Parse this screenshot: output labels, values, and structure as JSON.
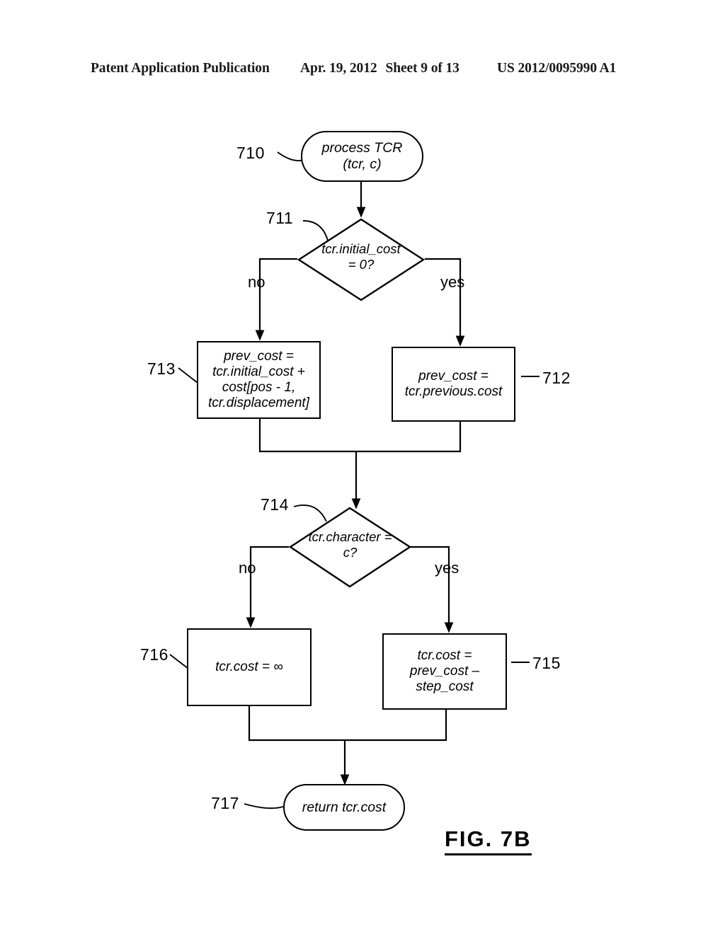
{
  "header": {
    "publication": "Patent Application Publication",
    "date": "Apr. 19, 2012",
    "sheet": "Sheet 9 of 13",
    "document_number": "US 2012/0095990 A1"
  },
  "figure": {
    "caption": "FIG. 7B"
  },
  "flowchart": {
    "nodes": [
      {
        "id": "710",
        "ref": "710",
        "type": "terminal",
        "text": "process TCR\n(tcr, c)"
      },
      {
        "id": "711",
        "ref": "711",
        "type": "decision",
        "text": "tcr.initial_cost\n= 0?"
      },
      {
        "id": "712",
        "ref": "712",
        "type": "process",
        "text": "prev_cost =\ntcr.previous.cost"
      },
      {
        "id": "713",
        "ref": "713",
        "type": "process",
        "text": "prev_cost =\ntcr.initial_cost +\ncost[pos - 1,\ntcr.displacement]"
      },
      {
        "id": "714",
        "ref": "714",
        "type": "decision",
        "text": "tcr.character =\nc?"
      },
      {
        "id": "715",
        "ref": "715",
        "type": "process",
        "text": "tcr.cost =\nprev_cost –\nstep_cost"
      },
      {
        "id": "716",
        "ref": "716",
        "type": "process",
        "text": "tcr.cost = ∞"
      },
      {
        "id": "717",
        "ref": "717",
        "type": "terminal",
        "text": "return tcr.cost"
      }
    ],
    "branch_labels": {
      "d711_no": "no",
      "d711_yes": "yes",
      "d714_no": "no",
      "d714_yes": "yes"
    },
    "colors": {
      "line": "#000000",
      "background": "#ffffff"
    }
  }
}
